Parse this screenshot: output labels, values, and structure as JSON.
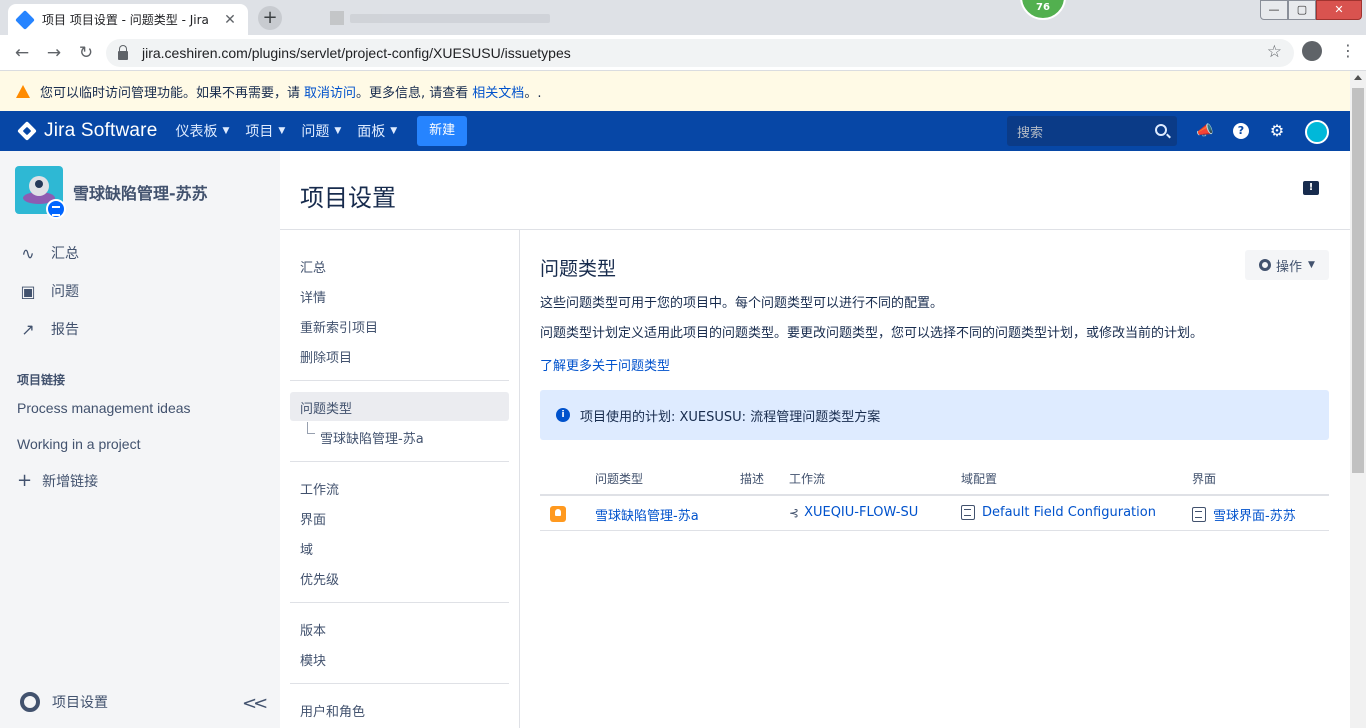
{
  "browser": {
    "tab_title": "项目 项目设置 - 问题类型 - Jira",
    "tab_close": "✕",
    "new_tab": "+",
    "url": "jira.ceshiren.com/plugins/servlet/project-config/XUESUSU/issuetypes",
    "badge_count": "76",
    "back": "←",
    "forward": "→",
    "reload": "↻",
    "star": "☆",
    "menu": "⋮",
    "win_min": "—",
    "win_max": "▢",
    "win_close": "✕"
  },
  "banner": {
    "text_before": "您可以临时访问管理功能。如果不再需要，请",
    "link_revoke": "取消访问",
    "text_middle": "。更多信息, 请查看",
    "link_docs": "相关文档",
    "text_after": "。."
  },
  "header": {
    "logo": "Jira Software",
    "nav": [
      {
        "label": "仪表板"
      },
      {
        "label": "项目"
      },
      {
        "label": "问题"
      },
      {
        "label": "面板"
      }
    ],
    "create_label": "新建",
    "search_placeholder": "搜索",
    "help": "?"
  },
  "sidebar": {
    "project_name": "雪球缺陷管理-苏苏",
    "nav": [
      {
        "label": "汇总",
        "icon": "pulse-icon"
      },
      {
        "label": "问题",
        "icon": "issues-icon"
      },
      {
        "label": "报告",
        "icon": "reports-icon"
      }
    ],
    "links_title": "项目链接",
    "links": [
      {
        "label": "Process management ideas"
      },
      {
        "label": "Working in a project"
      }
    ],
    "add_link": "新增链接",
    "footer": "项目设置",
    "collapse": "<<"
  },
  "page": {
    "title": "项目设置"
  },
  "settings_nav": {
    "group1": [
      "汇总",
      "详情",
      "重新索引项目",
      "删除项目"
    ],
    "selected": "问题类型",
    "sub_item": "雪球缺陷管理-苏a",
    "group2": [
      "工作流",
      "界面",
      "域",
      "优先级"
    ],
    "group3": [
      "版本",
      "模块"
    ],
    "group4": [
      "用户和角色"
    ]
  },
  "content": {
    "title": "问题类型",
    "actions_label": "操作",
    "desc1": "这些问题类型可用于您的项目中。每个问题类型可以进行不同的配置。",
    "desc2": "问题类型计划定义适用此项目的问题类型。要更改问题类型，您可以选择不同的问题类型计划，或修改当前的计划。",
    "learn_more": "了解更多关于问题类型",
    "info": "项目使用的计划: XUESUSU: 流程管理问题类型方案",
    "table": {
      "headers": [
        "问题类型",
        "描述",
        "工作流",
        "域配置",
        "界面"
      ],
      "rows": [
        {
          "issue_type": "雪球缺陷管理-苏a",
          "description": "",
          "workflow": "XUEQIU-FLOW-SU",
          "field_config": "Default Field Configuration",
          "screen": "雪球界面-苏苏"
        }
      ]
    }
  },
  "colors": {
    "header_bg": "#0747a6",
    "create_btn": "#2684ff",
    "link": "#0052cc",
    "banner_bg": "#fffae6",
    "info_bg": "#deebff",
    "issue_icon": "#ff991f"
  }
}
